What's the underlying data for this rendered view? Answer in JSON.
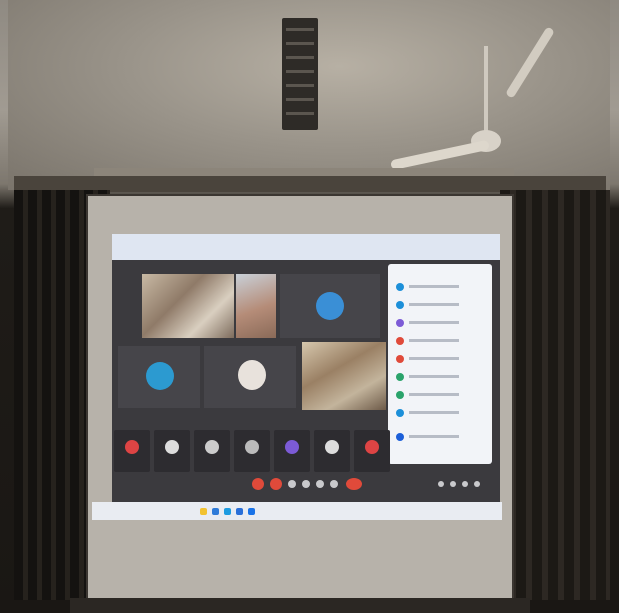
{
  "scene": {
    "description_free": true,
    "colors": {
      "ceiling": "#a19b92",
      "curtain": "#1a1714",
      "screen": "#b7b2aa",
      "meeting_bg": "#3b3a3e",
      "participants_panel": "#f2f4f8",
      "accent_blue": "#1c8fd9",
      "accent_red": "#e04a3a"
    }
  },
  "icons": {
    "ceiling_fan": "ceiling-fan-icon",
    "vent": "vent-icon",
    "avatar": "avatar-icon",
    "mic": "mic-icon",
    "end_call": "end-call-icon"
  }
}
